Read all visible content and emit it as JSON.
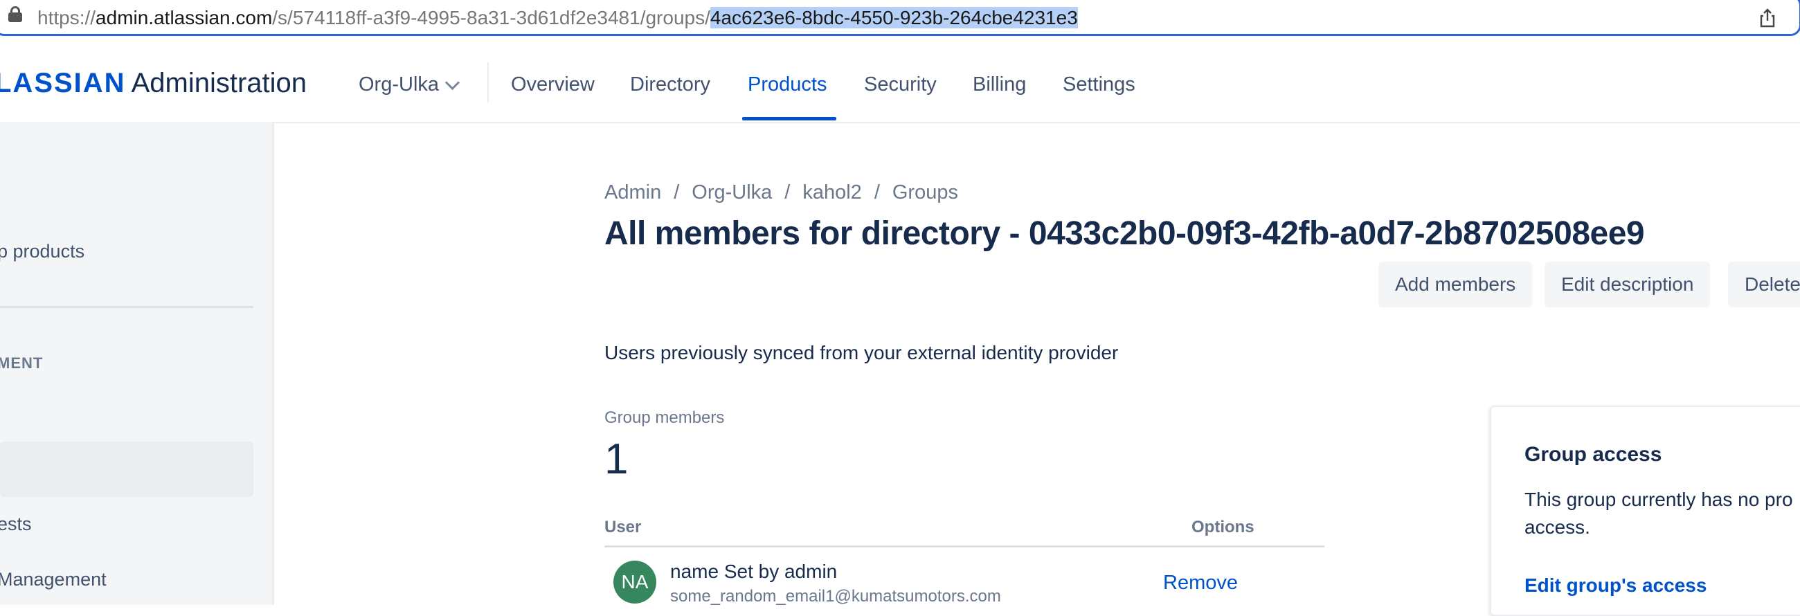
{
  "browser": {
    "url_prefix": "https://",
    "url_host": "admin.atlassian.com",
    "url_path": "/s/574118ff-a3f9-4995-8a31-3d61df2e3481/groups/",
    "url_selected": "4ac623e6-8bdc-4550-923b-264cbe4231e3"
  },
  "header": {
    "logo_word": "LASSIAN",
    "app_name": "Administration",
    "org": "Org-Ulka",
    "tabs": [
      "Overview",
      "Directory",
      "Products",
      "Security",
      "Billing",
      "Settings"
    ],
    "active_tab": "Products"
  },
  "sidebar": {
    "item_products": "p products",
    "section_heading": "MENT",
    "item_requests": "ests",
    "item_management": "Management"
  },
  "breadcrumb": [
    "Admin",
    "Org-Ulka",
    "kahol2",
    "Groups"
  ],
  "page": {
    "title": "All members for directory - 0433c2b0-09f3-42fb-a0d7-2b8702508ee9",
    "description": "Users previously synced from your external identity provider",
    "actions": {
      "add_members": "Add members",
      "edit_description": "Edit description",
      "delete": "Delete"
    },
    "members_label": "Group members",
    "members_count": "1"
  },
  "table": {
    "columns": {
      "user": "User",
      "options": "Options"
    },
    "rows": [
      {
        "initials": "NA",
        "name": "name Set by admin",
        "email": "some_random_email1@kumatsumotors.com",
        "action": "Remove",
        "avatar_color": "#36865e"
      }
    ]
  },
  "group_access": {
    "title": "Group access",
    "text_line1": "This group currently has no pro",
    "text_line2": "access.",
    "link": "Edit group's access"
  },
  "colors": {
    "accent": "#0052cc",
    "text": "#172b4d",
    "subtle": "#6b778c"
  }
}
